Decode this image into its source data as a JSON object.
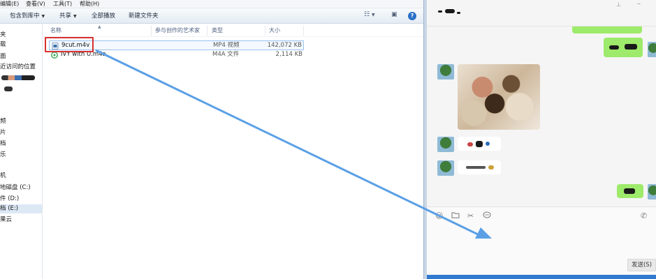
{
  "menu": [
    "编辑(E)",
    "查看(V)",
    "工具(T)",
    "帮助(H)"
  ],
  "toolbar": {
    "include_label": "包含到库中",
    "share_label": "共享",
    "play_all_label": "全部播放",
    "new_folder_label": "新建文件夹",
    "view_icon": "view-options-icon",
    "preview_icon": "preview-pane-icon",
    "help_label": "?"
  },
  "nav": {
    "items": [
      "夹",
      "载",
      "面",
      "近访问的位置",
      "频",
      "片",
      "档",
      "乐",
      "机",
      "地磁盘 (C:)",
      "件 (D:)",
      "档 (E:)",
      "果云"
    ]
  },
  "columns": {
    "name": "名称",
    "artist": "参与创作的艺术家",
    "type": "类型",
    "size": "大小"
  },
  "files": [
    {
      "name": "9cut.m4v",
      "type": "MP4 视频",
      "size": "142,072 KB",
      "icon": "video-file-icon"
    },
    {
      "name": "IVY with U.m4a",
      "type": "M4A 文件",
      "size": "2,114 KB",
      "icon": "audio-file-icon"
    }
  ],
  "chat": {
    "send_label": "发送(S)",
    "tools": [
      "emoji-icon",
      "folder-icon",
      "scissors-icon",
      "chat-history-icon"
    ],
    "call_icon": "phone-icon"
  },
  "colors": {
    "accent_blue": "#2f79d0",
    "arrow_blue": "#5ba0e6",
    "highlight_red": "#d83030",
    "bubble_green": "#9eea6a"
  }
}
